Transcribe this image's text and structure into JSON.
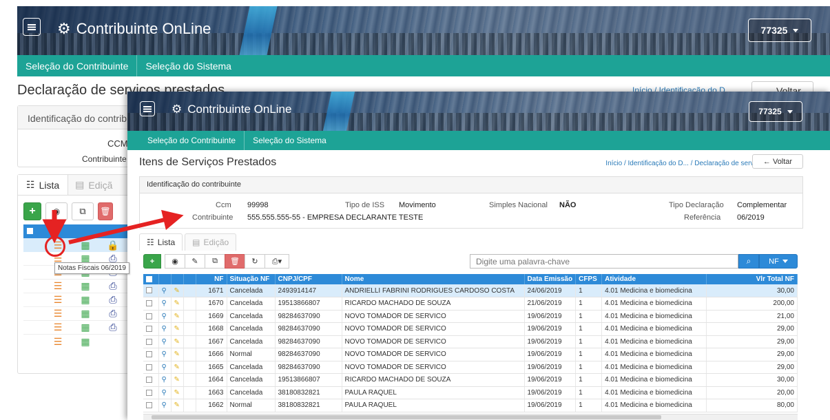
{
  "back": {
    "brand": "Contribuinte OnLine",
    "user": "77325",
    "nav": [
      "Seleção do Contribuinte",
      "Seleção do Sistema"
    ],
    "title": "Declaração de serviços prestados",
    "crumbs": "Início /  Identificação do D",
    "voltar": "← Voltar",
    "ident_header": "Identificação do contrib",
    "ccm_label": "CCM",
    "contrib_label": "Contribuinte",
    "tab_lista": "Lista",
    "tab_edicao": "Ediçã",
    "tooltip": "Notas Fiscais 06/2019"
  },
  "front": {
    "brand": "Contribuinte OnLine",
    "user": "77325",
    "nav": [
      "Seleção do Contribuinte",
      "Seleção do Sistema"
    ],
    "title": "Itens de Serviços Prestados",
    "crumbs": "Início  /  Identificação do D...  /  Declaração de serv...",
    "voltar": "← Voltar",
    "ident_header": "Identificação do contribuinte",
    "ident": {
      "ccm_label": "Ccm",
      "ccm_value": "99998",
      "contrib_label": "Contribuinte",
      "contrib_value": "555.555.555-55 - EMPRESA DECLARANTE TESTE",
      "tipo_iss_label": "Tipo de ISS",
      "tipo_iss_value": "Movimento",
      "simples_label": "Simples Nacional",
      "simples_value": "NÃO",
      "tipo_decl_label": "Tipo Declaração",
      "tipo_decl_value": "Complementar",
      "ref_label": "Referência",
      "ref_value": "06/2019"
    },
    "tab_lista": "Lista",
    "tab_edicao": "Edição",
    "search_placeholder": "Digite uma palavra-chave",
    "nf_button": "NF",
    "columns": [
      "NF",
      "Situação NF",
      "CNPJ/CPF",
      "Nome",
      "Data Emissão",
      "CFPS",
      "Atividade",
      "Vlr Total NF"
    ],
    "rows": [
      [
        "1671",
        "Cancelada",
        "2493914147",
        "ANDRIELLI FABRINI RODRIGUES CARDOSO COSTA",
        "24/06/2019",
        "1",
        "4.01 Medicina e biomedicina",
        "30,00"
      ],
      [
        "1670",
        "Cancelada",
        "19513866807",
        "RICARDO MACHADO DE SOUZA",
        "21/06/2019",
        "1",
        "4.01 Medicina e biomedicina",
        "200,00"
      ],
      [
        "1669",
        "Cancelada",
        "98284637090",
        "NOVO TOMADOR DE SERVICO",
        "19/06/2019",
        "1",
        "4.01 Medicina e biomedicina",
        "21,00"
      ],
      [
        "1668",
        "Cancelada",
        "98284637090",
        "NOVO TOMADOR DE SERVICO",
        "19/06/2019",
        "1",
        "4.01 Medicina e biomedicina",
        "29,00"
      ],
      [
        "1667",
        "Cancelada",
        "98284637090",
        "NOVO TOMADOR DE SERVICO",
        "19/06/2019",
        "1",
        "4.01 Medicina e biomedicina",
        "29,00"
      ],
      [
        "1666",
        "Normal",
        "98284637090",
        "NOVO TOMADOR DE SERVICO",
        "19/06/2019",
        "1",
        "4.01 Medicina e biomedicina",
        "29,00"
      ],
      [
        "1665",
        "Cancelada",
        "98284637090",
        "NOVO TOMADOR DE SERVICO",
        "19/06/2019",
        "1",
        "4.01 Medicina e biomedicina",
        "29,00"
      ],
      [
        "1664",
        "Cancelada",
        "19513866807",
        "RICARDO MACHADO DE SOUZA",
        "19/06/2019",
        "1",
        "4.01 Medicina e biomedicina",
        "30,00"
      ],
      [
        "1663",
        "Cancelada",
        "38180832821",
        "PAULA RAQUEL",
        "19/06/2019",
        "1",
        "4.01 Medicina e biomedicina",
        "20,00"
      ],
      [
        "1662",
        "Normal",
        "38180832821",
        "PAULA RAQUEL",
        "19/06/2019",
        "1",
        "4.01 Medicina e biomedicina",
        "80,00"
      ]
    ]
  },
  "colors": {
    "teal_nav": "#1da396",
    "table_header": "#2d8ad8",
    "annotation": "#e52222",
    "green_btn": "#3aa54a",
    "red_btn": "#e06b6b"
  }
}
